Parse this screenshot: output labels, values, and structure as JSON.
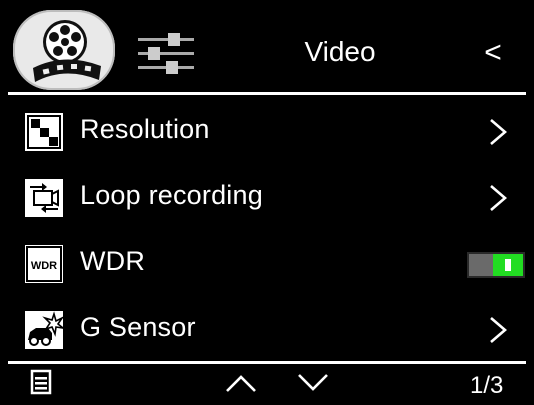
{
  "header": {
    "title": "Video",
    "tabs": [
      {
        "icon": "film-reel-icon",
        "selected": true
      },
      {
        "icon": "settings-sliders-icon",
        "selected": false
      }
    ],
    "back_icon": "chevron-left-icon",
    "back_glyph": "<"
  },
  "menu": {
    "items": [
      {
        "label": "Resolution",
        "icon": "resolution-icon",
        "control": "chevron-right"
      },
      {
        "label": "Loop recording",
        "icon": "loop-recording-icon",
        "control": "chevron-right"
      },
      {
        "label": "WDR",
        "icon": "wdr-icon",
        "control": "toggle",
        "toggle_on": true
      },
      {
        "label": "G Sensor",
        "icon": "g-sensor-icon",
        "control": "chevron-right"
      }
    ]
  },
  "footer": {
    "page": "1/3",
    "icons": [
      "menu-list-icon",
      "chevron-up-icon",
      "chevron-down-icon"
    ]
  },
  "colors": {
    "background": "#000000",
    "text": "#ffffff",
    "toggle_on": "#22dd22",
    "tab_selected_bg": "#e9e9e9"
  }
}
